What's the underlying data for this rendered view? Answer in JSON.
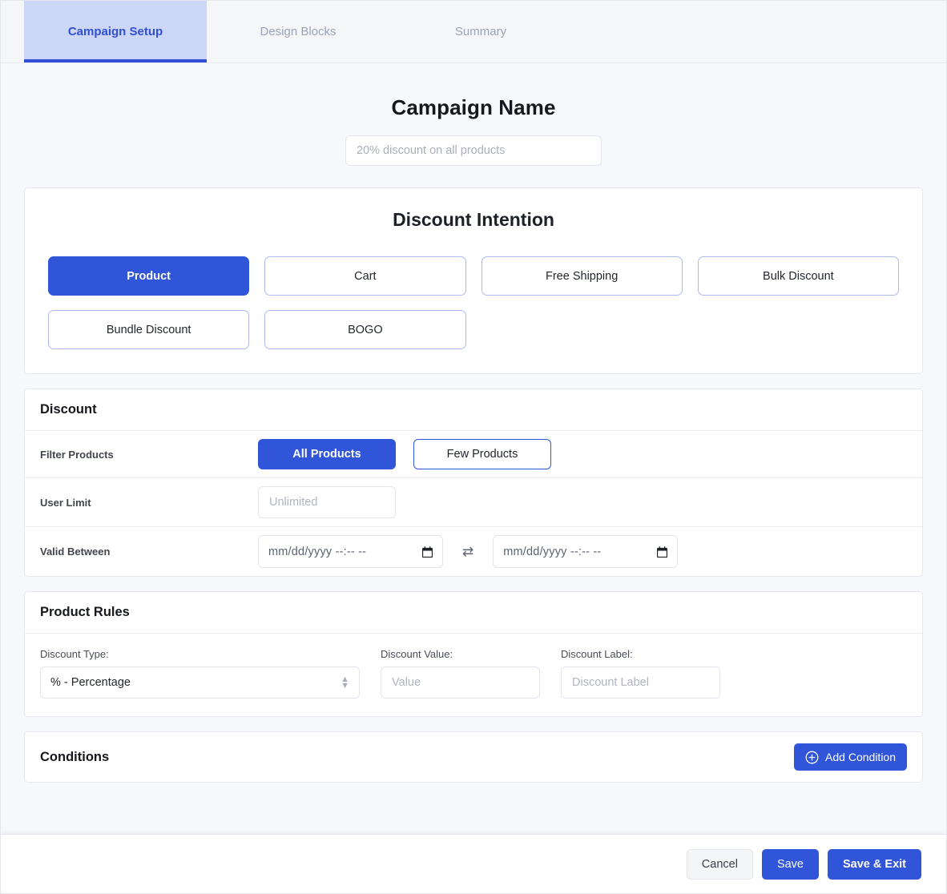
{
  "tabs": [
    {
      "label": "Campaign Setup",
      "active": true
    },
    {
      "label": "Design Blocks",
      "active": false
    },
    {
      "label": "Summary",
      "active": false
    }
  ],
  "campaign": {
    "title": "Campaign Name",
    "input_value": "",
    "input_placeholder": "20% discount on all products"
  },
  "intention": {
    "title": "Discount Intention",
    "options": [
      {
        "label": "Product",
        "selected": true
      },
      {
        "label": "Cart",
        "selected": false
      },
      {
        "label": "Free Shipping",
        "selected": false
      },
      {
        "label": "Bulk Discount",
        "selected": false
      },
      {
        "label": "Bundle Discount",
        "selected": false
      },
      {
        "label": "BOGO",
        "selected": false
      }
    ]
  },
  "discount": {
    "title": "Discount",
    "filter_products": {
      "label": "Filter Products",
      "options": [
        {
          "label": "All Products",
          "selected": true
        },
        {
          "label": "Few Products",
          "selected": false
        }
      ]
    },
    "user_limit": {
      "label": "User Limit",
      "value": "",
      "placeholder": "Unlimited"
    },
    "valid_between": {
      "label": "Valid Between",
      "start_value": "mm/dd/yyyy --:-- --",
      "end_value": "mm/dd/yyyy --:-- --",
      "swap_glyph": "⇄"
    }
  },
  "product_rules": {
    "title": "Product Rules",
    "discount_type": {
      "label": "Discount Type:",
      "selected": "% - Percentage"
    },
    "discount_value": {
      "label": "Discount Value:",
      "value": "",
      "placeholder": "Value"
    },
    "discount_label": {
      "label": "Discount Label:",
      "value": "",
      "placeholder": "Discount Label"
    }
  },
  "conditions": {
    "title": "Conditions",
    "add_button": "Add Condition"
  },
  "footer": {
    "cancel": "Cancel",
    "save": "Save",
    "save_exit": "Save & Exit"
  },
  "colors": {
    "primary": "#3055d8",
    "tab_active_bg": "#ccd6f7",
    "tab_active_text": "#2f4fd4",
    "page_bg": "#f7f8fb",
    "muted_text": "#9aa3b8"
  }
}
